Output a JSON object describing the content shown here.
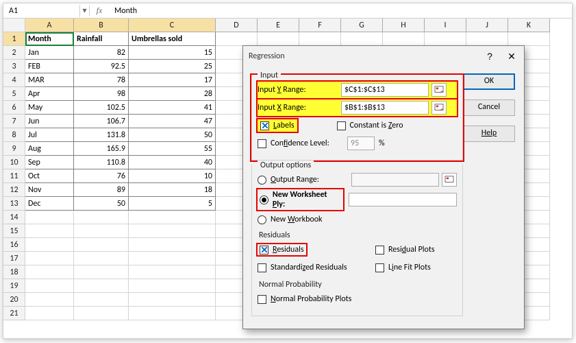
{
  "formula_bar": {
    "name_box": "A1",
    "fx_label": "fx",
    "value": "Month"
  },
  "columns": [
    "A",
    "B",
    "C",
    "D",
    "E",
    "F",
    "G",
    "H",
    "I",
    "J",
    "K"
  ],
  "headers": {
    "A": "Month",
    "B": "Rainfall",
    "C": "Umbrellas sold"
  },
  "rows": [
    {
      "n": 1,
      "A": "Month",
      "B": "Rainfall",
      "C": "Umbrellas sold"
    },
    {
      "n": 2,
      "A": "Jan",
      "B": "82",
      "C": "15"
    },
    {
      "n": 3,
      "A": "FEB",
      "B": "92.5",
      "C": "25"
    },
    {
      "n": 4,
      "A": "MAR",
      "B": "78",
      "C": "17"
    },
    {
      "n": 5,
      "A": "Apr",
      "B": "98",
      "C": "28"
    },
    {
      "n": 6,
      "A": "May",
      "B": "102.5",
      "C": "41"
    },
    {
      "n": 7,
      "A": "Jun",
      "B": "106.7",
      "C": "47"
    },
    {
      "n": 8,
      "A": "Jul",
      "B": "131.8",
      "C": "50"
    },
    {
      "n": 9,
      "A": "Aug",
      "B": "165.9",
      "C": "55"
    },
    {
      "n": 10,
      "A": "Sep",
      "B": "110.8",
      "C": "40"
    },
    {
      "n": 11,
      "A": "Oct",
      "B": "76",
      "C": "10"
    },
    {
      "n": 12,
      "A": "Nov",
      "B": "89",
      "C": "18"
    },
    {
      "n": 13,
      "A": "Dec",
      "B": "50",
      "C": "5"
    }
  ],
  "empty_rows": [
    14,
    15,
    16,
    17,
    18,
    19,
    20,
    21
  ],
  "dialog": {
    "title": "Regression",
    "help_q": "?",
    "close_x": "✕",
    "buttons": {
      "ok": "OK",
      "cancel": "Cancel",
      "help": "Help"
    },
    "input": {
      "group": "Input",
      "yrange_label_pre": "Input ",
      "yrange_key": "Y",
      "yrange_label_post": " Range:",
      "yrange_value": "$C$1:$C$13",
      "xrange_label_pre": "Input ",
      "xrange_key": "X",
      "xrange_label_post": " Range:",
      "xrange_value": "$B$1:$B$13",
      "labels_key": "L",
      "labels_text": "abels",
      "constzero_pre": "Constant is ",
      "constzero_key": "Z",
      "constzero_post": "ero",
      "conf_pre": "Con",
      "conf_key": "f",
      "conf_post": "idence Level:",
      "conf_value": "95",
      "conf_pct": "%"
    },
    "output": {
      "group": "Output options",
      "outrange_key": "O",
      "outrange_text": "utput Range:",
      "ply_pre": "New Worksheet ",
      "ply_key": "P",
      "ply_post": "ly:",
      "workbook_pre": "New ",
      "workbook_key": "W",
      "workbook_post": "orkbook"
    },
    "residuals": {
      "group": "Residuals",
      "res_key": "R",
      "res_text": "esiduals",
      "std_pre": "Standardi",
      "std_key": "z",
      "std_post": "ed Residuals",
      "rplot_pre": "Resi",
      "rplot_key": "d",
      "rplot_post": "ual Plots",
      "lplot_pre": "L",
      "lplot_key": "i",
      "lplot_post": "ne Fit Plots"
    },
    "normal": {
      "group": "Normal Probability",
      "np_key": "N",
      "np_text": "ormal Probability Plots"
    }
  },
  "chart_data": {
    "type": "table",
    "title": "Rainfall vs Umbrellas sold by Month",
    "columns": [
      "Month",
      "Rainfall",
      "Umbrellas sold"
    ],
    "rows": [
      [
        "Jan",
        82,
        15
      ],
      [
        "FEB",
        92.5,
        25
      ],
      [
        "MAR",
        78,
        17
      ],
      [
        "Apr",
        98,
        28
      ],
      [
        "May",
        102.5,
        41
      ],
      [
        "Jun",
        106.7,
        47
      ],
      [
        "Jul",
        131.8,
        50
      ],
      [
        "Aug",
        165.9,
        55
      ],
      [
        "Sep",
        110.8,
        40
      ],
      [
        "Oct",
        76,
        10
      ],
      [
        "Nov",
        89,
        18
      ],
      [
        "Dec",
        50,
        5
      ]
    ]
  }
}
